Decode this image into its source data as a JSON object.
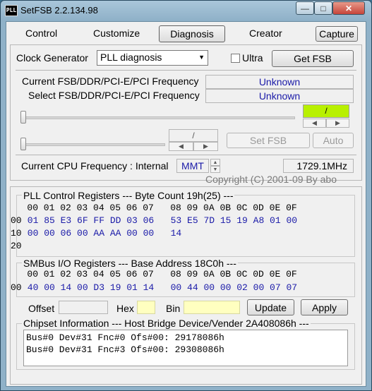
{
  "window": {
    "title": "SetFSB 2.2.134.98",
    "app_icon_text": "PLL"
  },
  "tabs": [
    "Control",
    "Customize",
    "Diagnosis",
    "Creator"
  ],
  "capture_label": "Capture",
  "clock": {
    "label": "Clock Generator",
    "selected": "PLL diagnosis",
    "ultra_label": "Ultra",
    "get_fsb_label": "Get FSB"
  },
  "freq": {
    "current_label": "Current FSB/DDR/PCI-E/PCI Frequency",
    "current_value": "Unknown",
    "select_label": "Select FSB/DDR/PCI-E/PCI Frequency",
    "select_value": "Unknown",
    "indicator_text": "/",
    "mid_indicator_text": "/",
    "set_fsb_label": "Set FSB",
    "auto_label": "Auto"
  },
  "cpu": {
    "label": "Current CPU Frequency : Internal",
    "mode": "MMT",
    "value": "1729.1MHz",
    "copyright": "Copyright (C) 2001-09 By abo"
  },
  "pll": {
    "title": "PLL Control Registers  --- Byte Count 19h(25) ---",
    "header": "   00 01 02 03 04 05 06 07   08 09 0A 0B 0C 0D 0E 0F",
    "rows": [
      {
        "addr": "00",
        "values": " 01 85 E3 6F FF DD 03 06   53 E5 7D 15 19 A8 01 00"
      },
      {
        "addr": "10",
        "values": " 00 00 06 00 AA AA 00 00   14"
      },
      {
        "addr": "20",
        "values": ""
      }
    ]
  },
  "smbus": {
    "title": "SMBus I/O Registers  --- Base Address 18C0h ---",
    "header": "   00 01 02 03 04 05 06 07   08 09 0A 0B 0C 0D 0E 0F",
    "rows": [
      {
        "addr": "00",
        "values": " 40 00 14 00 D3 19 01 14   00 44 00 00 02 00 07 07"
      }
    ]
  },
  "io": {
    "offset_label": "Offset",
    "offset_value": "",
    "hex_label": "Hex",
    "hex_value": "",
    "bin_label": "Bin",
    "bin_value": "",
    "update_label": "Update",
    "apply_label": "Apply"
  },
  "chipset": {
    "title": "Chipset Information  --- Host Bridge Device/Vender 2A408086h ---",
    "lines": [
      "Bus#0 Dev#31 Fnc#0 Ofs#00: 29178086h",
      "Bus#0 Dev#31 Fnc#3 Ofs#00: 29308086h"
    ]
  },
  "colors": {
    "value_blue": "#1a1aa8",
    "indicator_green": "#b8f000",
    "hex_field_bg": "#ffffc0"
  }
}
